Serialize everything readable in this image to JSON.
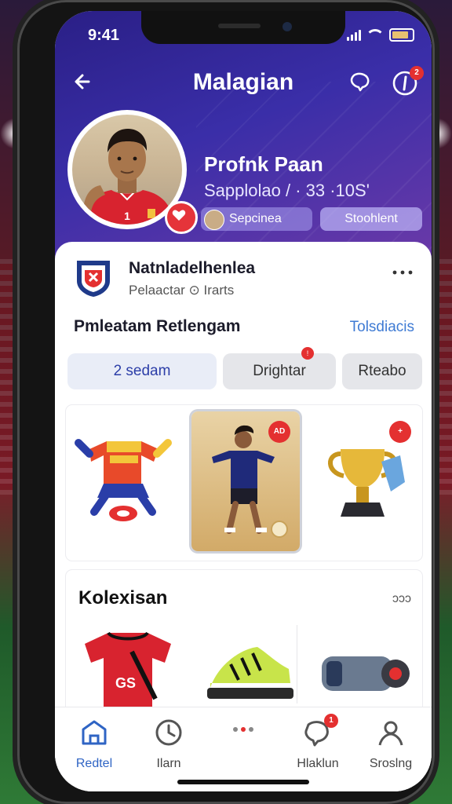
{
  "status_bar": {
    "time": "9:41"
  },
  "header": {
    "title": "Malagian"
  },
  "profile": {
    "name": "Profnk Paan",
    "subtitle": "Sapplolao / · 33 ·10S'",
    "pill_primary": "Sepcinea",
    "pill_secondary": "Stoohlent",
    "notif_badge": "2"
  },
  "club": {
    "name": "Natnladelhenlea",
    "subtitle": "Pelaactar ⊙ Irarts"
  },
  "section": {
    "title": "Pmleatam Retlengam",
    "link": "Tolsdiacis"
  },
  "tabs": [
    {
      "label": "2 sedam"
    },
    {
      "label": "Drightar"
    },
    {
      "label": "Rteabo"
    }
  ],
  "items": [
    {
      "name": "jersey-figure"
    },
    {
      "name": "player-card",
      "badge": "AD"
    },
    {
      "name": "trophy",
      "badge": "+"
    }
  ],
  "collection": {
    "title": "Kolexisan",
    "more": "ɔɔɔ",
    "jersey_text": "GS"
  },
  "bottom_nav": [
    {
      "label": "Redtel"
    },
    {
      "label": "Ilarn"
    },
    {
      "label": ""
    },
    {
      "label": "Hlaklun",
      "badge": "1"
    },
    {
      "label": "Sroslng"
    }
  ],
  "colors": {
    "header_start": "#2a1f86",
    "accent": "#2f64c4",
    "badge": "#e43030"
  }
}
